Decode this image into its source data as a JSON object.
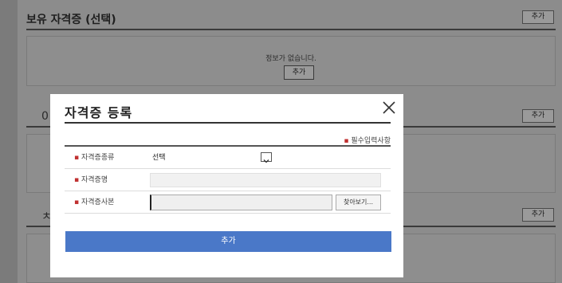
{
  "background": {
    "section1": {
      "title": "보유 자격증 (선택)",
      "add_label": "추가",
      "empty_text": "정보가 없습니다.",
      "empty_add_label": "추가"
    },
    "section2": {
      "title_stub": "0",
      "add_label": "추가"
    },
    "section3": {
      "title_stub": "ㅊ",
      "add_label": "추가"
    }
  },
  "modal": {
    "title": "자격증 등록",
    "required_note": "필수입력사항",
    "fields": [
      {
        "label": "자격증종류",
        "value": "선택"
      },
      {
        "label": "자격증명",
        "value": ""
      },
      {
        "label": "자격증사본",
        "value": "",
        "browse_label": "찾아보기..."
      }
    ],
    "submit_label": "추가"
  },
  "colors": {
    "accent": "#4a78c8",
    "required_dot": "#c03030",
    "overlay": "#7b7b7b"
  },
  "icons": {
    "close": "close-icon",
    "select_arrow": "chevron-down-icon"
  }
}
